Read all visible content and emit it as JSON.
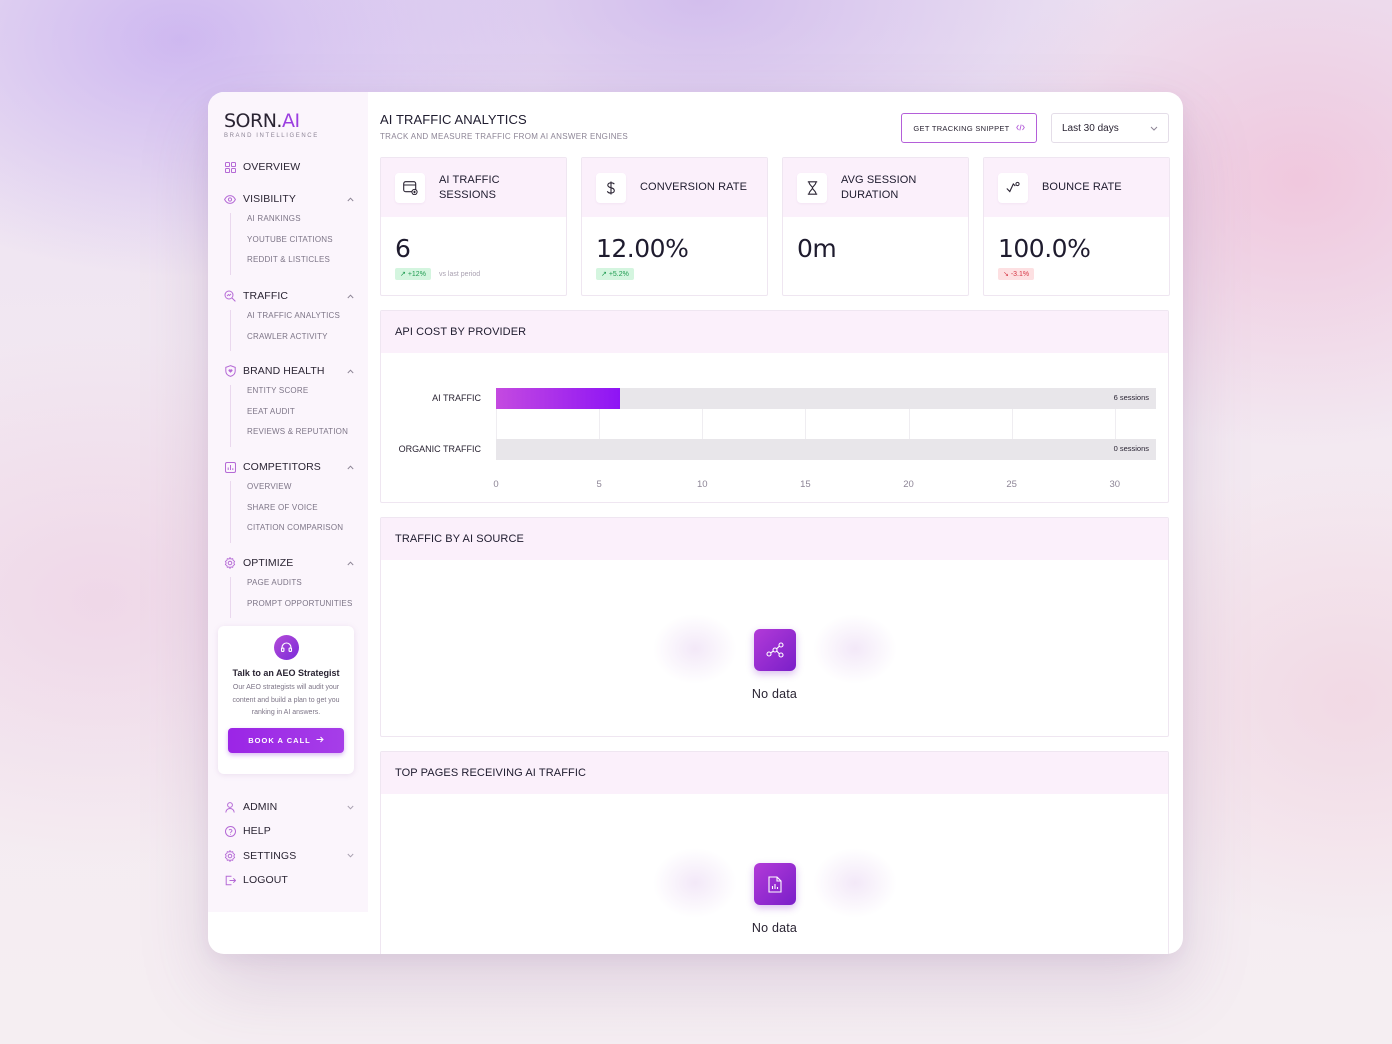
{
  "brand": {
    "name_main": "SORN.",
    "name_accent": "AI",
    "tagline": "BRAND INTELLIGENCE"
  },
  "sidebar": {
    "overview": "OVERVIEW",
    "sections": [
      {
        "label": "VISIBILITY",
        "items": [
          "AI RANKINGS",
          "YOUTUBE CITATIONS",
          "REDDIT & LISTICLES"
        ]
      },
      {
        "label": "TRAFFIC",
        "items": [
          "AI TRAFFIC ANALYTICS",
          "CRAWLER ACTIVITY"
        ]
      },
      {
        "label": "BRAND HEALTH",
        "items": [
          "ENTITY SCORE",
          "EEAT AUDIT",
          "REVIEWS & REPUTATION"
        ]
      },
      {
        "label": "COMPETITORS",
        "items": [
          "OVERVIEW",
          "SHARE OF VOICE",
          "CITATION COMPARISON"
        ]
      },
      {
        "label": "OPTIMIZE",
        "items": [
          "PAGE AUDITS",
          "PROMPT OPPORTUNITIES"
        ]
      }
    ],
    "cta": {
      "title": "Talk to an AEO Strategist",
      "text": "Our AEO strategists will audit your content and build a plan to get you ranking in AI answers.",
      "button": "BOOK A CALL"
    },
    "bottom": [
      "ADMIN",
      "HELP",
      "SETTINGS",
      "LOGOUT"
    ]
  },
  "header": {
    "title": "AI TRAFFIC ANALYTICS",
    "subtitle": "TRACK AND MEASURE TRAFFIC FROM AI ANSWER ENGINES",
    "tracking_button": "GET TRACKING SNIPPET",
    "date_range": "Last 30 days"
  },
  "kpis": [
    {
      "label": "AI TRAFFIC SESSIONS",
      "value": "6",
      "delta": "+12%",
      "trend": "up",
      "note": "vs last period",
      "icon": "browser-plus-icon"
    },
    {
      "label": "CONVERSION RATE",
      "value": "12.00%",
      "delta": "+5.2%",
      "trend": "up",
      "note": "",
      "icon": "dollar-icon"
    },
    {
      "label": "AVG SESSION DURATION",
      "value": "0m",
      "delta": "",
      "trend": "",
      "note": "",
      "icon": "hourglass-icon"
    },
    {
      "label": "BOUNCE RATE",
      "value": "100.0%",
      "delta": "-3.1%",
      "trend": "down",
      "note": "",
      "icon": "bounce-arrow-icon"
    }
  ],
  "panels": {
    "api_cost": "API COST BY PROVIDER",
    "traffic_source": "TRAFFIC BY AI SOURCE",
    "top_pages": "TOP PAGES RECEIVING AI TRAFFIC",
    "empty_text": "No data"
  },
  "chart_data": {
    "type": "bar",
    "orientation": "horizontal",
    "title": "API COST BY PROVIDER",
    "categories": [
      "AI TRAFFIC",
      "ORGANIC TRAFFIC"
    ],
    "values": [
      6,
      0
    ],
    "value_labels": [
      "6 sessions",
      "0 sessions"
    ],
    "xlim": [
      0,
      32
    ],
    "xticks": [
      "0",
      "5",
      "10",
      "15",
      "20",
      "25",
      "30"
    ],
    "grid": true,
    "colors": {
      "fill_start": "#c44ae0",
      "fill_end": "#8e14f5",
      "track": "#e8e6ea"
    }
  },
  "colors": {
    "accent": "#9b3ee0",
    "panel_header": "#fbf0fb",
    "up": "#1f9b50",
    "down": "#d63645"
  }
}
